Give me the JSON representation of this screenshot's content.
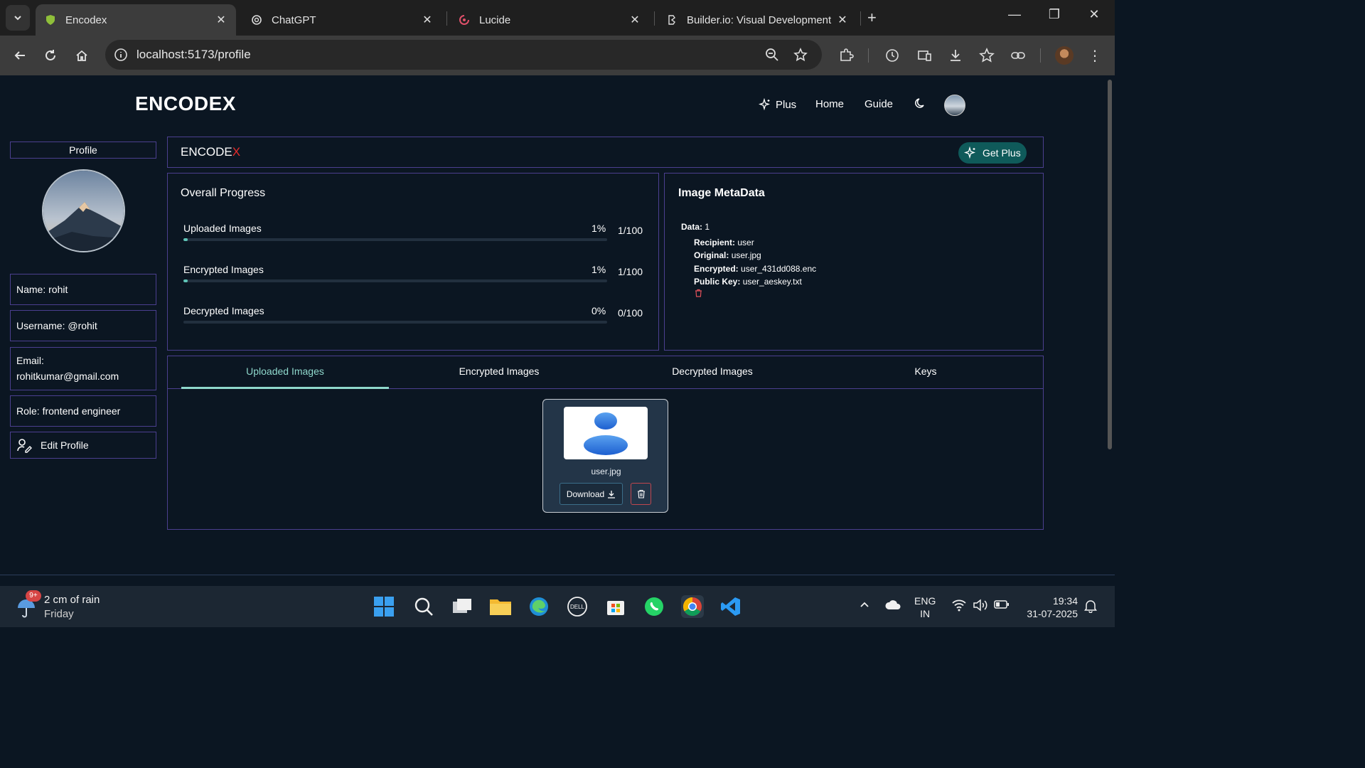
{
  "browser": {
    "tabs": [
      {
        "title": "Encodex",
        "active": true
      },
      {
        "title": "ChatGPT",
        "active": false
      },
      {
        "title": "Lucide",
        "active": false
      },
      {
        "title": "Builder.io: Visual Development",
        "active": false
      }
    ],
    "url": "localhost:5173/profile"
  },
  "app": {
    "brand": "ENCODEX",
    "nav": {
      "plus": "Plus",
      "home": "Home",
      "guide": "Guide"
    },
    "brand_bar": {
      "logo_main": "ENCODE",
      "logo_accent": "X",
      "get_plus": "Get Plus"
    },
    "profile": {
      "heading": "Profile",
      "name": "Name: rohit",
      "username": "Username: @rohit",
      "email_label": "Email:",
      "email_value": "rohitkumar@gmail.com",
      "role": "Role: frontend engineer",
      "edit": "Edit Profile"
    },
    "progress": {
      "title": "Overall Progress",
      "rows": [
        {
          "label": "Uploaded Images",
          "percent": "1%",
          "count": "1/100",
          "fraction": 0.01
        },
        {
          "label": "Encrypted Images",
          "percent": "1%",
          "count": "1/100",
          "fraction": 0.01
        },
        {
          "label": "Decrypted Images",
          "percent": "0%",
          "count": "0/100",
          "fraction": 0
        }
      ]
    },
    "metadata": {
      "title": "Image MetaData",
      "data_label": "Data:",
      "data_value": "1",
      "recipient_label": "Recipient:",
      "recipient_value": "user",
      "original_label": "Original:",
      "original_value": "user.jpg",
      "encrypted_label": "Encrypted:",
      "encrypted_value": "user_431dd088.enc",
      "public_key_label": "Public Key:",
      "public_key_value": "user_aeskey.txt"
    },
    "tabs": [
      "Uploaded Images",
      "Encrypted Images",
      "Decrypted Images",
      "Keys"
    ],
    "card": {
      "file_name": "user.jpg",
      "download": "Download"
    }
  },
  "taskbar": {
    "weather_main": "2 cm of rain",
    "weather_sub": "Friday",
    "badge": "9+",
    "lang_1": "ENG",
    "lang_2": "IN",
    "time": "19:34",
    "date": "31-07-2025"
  },
  "colors": {
    "accent": "#8fd8cc",
    "brand_x": "#e52b2b",
    "border": "#4b3f8f",
    "plus_button": "#0f5a5a"
  }
}
